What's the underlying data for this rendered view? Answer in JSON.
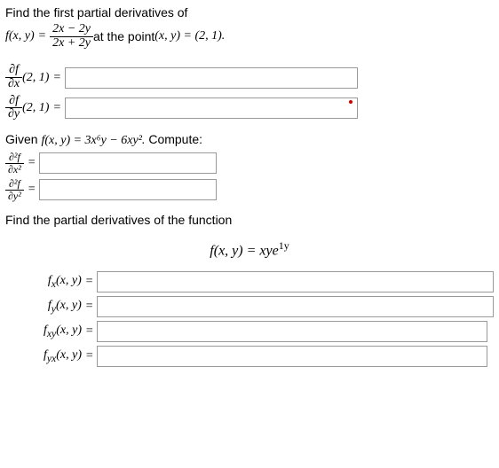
{
  "q1": {
    "prompt": "Find the first partial derivatives of",
    "func_left": "f(x, y)",
    "frac_num": "2x − 2y",
    "frac_den": "2x + 2y",
    "at_text": " at the point ",
    "point": "(x, y) = (2, 1).",
    "dfx_num": "∂f",
    "dfx_den": "∂x",
    "dfy_num": "∂f",
    "dfy_den": "∂y",
    "pt": "(2, 1)"
  },
  "q2": {
    "given": "Given ",
    "func": "f(x, y) = 3x⁶y − 6xy².",
    "compute": " Compute:",
    "d2x_num": "∂²f",
    "d2x_den": "∂x²",
    "d2y_num": "∂²f",
    "d2y_den": "∂y²"
  },
  "q3": {
    "prompt": "Find the partial derivatives of the function",
    "func_lhs": "f(x, y) = xye",
    "func_exp": "1y",
    "fx": "fₓ(x, y)",
    "fy": "f_y(x, y)",
    "fxy": "f_xy(x, y)",
    "fyx": "f_yx(x, y)"
  },
  "eq": "="
}
